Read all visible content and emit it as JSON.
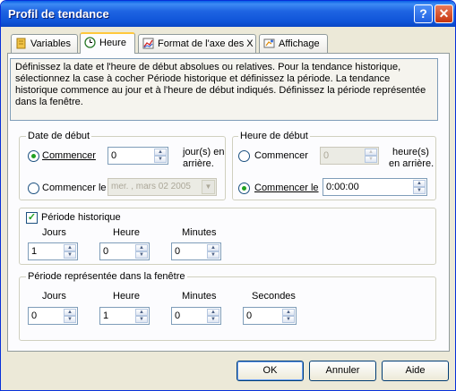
{
  "window": {
    "title": "Profil de tendance",
    "help_button": "?",
    "close_button": "✕"
  },
  "tabs": [
    {
      "label": "Variables"
    },
    {
      "label": "Heure"
    },
    {
      "label": "Format de l'axe des X"
    },
    {
      "label": "Affichage"
    }
  ],
  "description": "Définissez la date et l'heure de début absolues ou relatives. Pour la tendance historique, sélectionnez la case à cocher Période historique et définissez la période. La tendance historique commence au jour et à l'heure de début indiqués. Définissez la période représentée dans la fenêtre.",
  "date_debut": {
    "group_label": "Date de début",
    "commencer_label": "Commencer",
    "commencer_value": "0",
    "suffix_line1": "jour(s) en",
    "suffix_line2": "arrière.",
    "commencer_le_label": "Commencer le",
    "date_value": "mer. , mars 02 2005"
  },
  "heure_debut": {
    "group_label": "Heure de début",
    "commencer_label": "Commencer",
    "commencer_value": "0",
    "suffix_line1": "heure(s)",
    "suffix_line2": "en arrière.",
    "commencer_le_label": "Commencer le",
    "time_value": "0:00:00"
  },
  "periode_historique": {
    "label": "Période historique",
    "checked": true,
    "jours_label": "Jours",
    "jours_value": "1",
    "heure_label": "Heure",
    "heure_value": "0",
    "minutes_label": "Minutes",
    "minutes_value": "0"
  },
  "periode_fenetre": {
    "group_label": "Période représentée dans la fenêtre",
    "jours_label": "Jours",
    "jours_value": "0",
    "heure_label": "Heure",
    "heure_value": "1",
    "minutes_label": "Minutes",
    "minutes_value": "0",
    "secondes_label": "Secondes",
    "secondes_value": "0"
  },
  "buttons": {
    "ok": "OK",
    "cancel": "Annuler",
    "help": "Aide"
  },
  "colors": {
    "titlebar": "#0a5fe6",
    "window_bg": "#ece9d8",
    "radio_dot": "#21a121",
    "tab_highlight": "#ffc83c"
  }
}
